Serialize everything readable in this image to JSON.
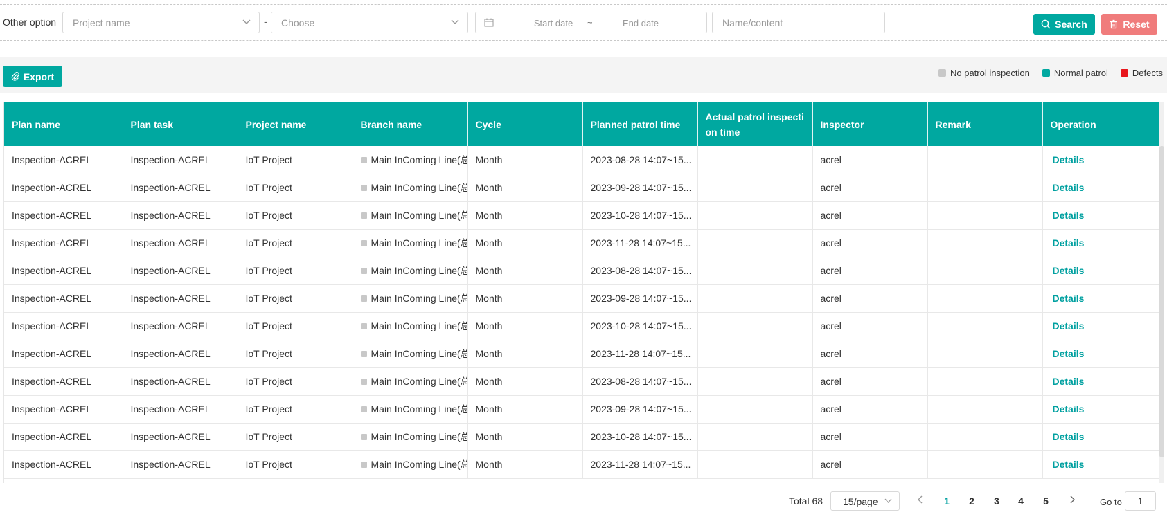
{
  "filters": {
    "label": "Other option",
    "project_placeholder": "Project name",
    "separator": "-",
    "choose_placeholder": "Choose",
    "start_placeholder": "Start date",
    "range_separator": "~",
    "end_placeholder": "End date",
    "name_placeholder": "Name/content",
    "search_label": "Search",
    "reset_label": "Reset"
  },
  "toolbar": {
    "export_label": "Export",
    "legend": [
      {
        "label": "No patrol inspection",
        "color": "#c8c8c8"
      },
      {
        "label": "Normal patrol",
        "color": "#00a8a0"
      },
      {
        "label": "Defects",
        "color": "#e8151b"
      }
    ]
  },
  "table": {
    "columns": [
      "Plan name",
      "Plan task",
      "Project name",
      "Branch name",
      "Cycle",
      "Planned patrol time",
      "Actual patrol inspecti on time",
      "Inspector",
      "Remark",
      "Operation"
    ],
    "rows": [
      {
        "plan": "Inspection-ACREL",
        "task": "Inspection-ACREL",
        "project": "IoT Project",
        "branch": "Main InComing Line(总",
        "cycle": "Month",
        "planned": "2023-08-28 14:07~15...",
        "actual": "",
        "inspector": "acrel",
        "remark": "",
        "op": "Details"
      },
      {
        "plan": "Inspection-ACREL",
        "task": "Inspection-ACREL",
        "project": "IoT Project",
        "branch": "Main InComing Line(总",
        "cycle": "Month",
        "planned": "2023-09-28 14:07~15...",
        "actual": "",
        "inspector": "acrel",
        "remark": "",
        "op": "Details"
      },
      {
        "plan": "Inspection-ACREL",
        "task": "Inspection-ACREL",
        "project": "IoT Project",
        "branch": "Main InComing Line(总",
        "cycle": "Month",
        "planned": "2023-10-28 14:07~15...",
        "actual": "",
        "inspector": "acrel",
        "remark": "",
        "op": "Details"
      },
      {
        "plan": "Inspection-ACREL",
        "task": "Inspection-ACREL",
        "project": "IoT Project",
        "branch": "Main InComing Line(总",
        "cycle": "Month",
        "planned": "2023-11-28 14:07~15...",
        "actual": "",
        "inspector": "acrel",
        "remark": "",
        "op": "Details"
      },
      {
        "plan": "Inspection-ACREL",
        "task": "Inspection-ACREL",
        "project": "IoT Project",
        "branch": "Main InComing Line(总",
        "cycle": "Month",
        "planned": "2023-08-28 14:07~15...",
        "actual": "",
        "inspector": "acrel",
        "remark": "",
        "op": "Details"
      },
      {
        "plan": "Inspection-ACREL",
        "task": "Inspection-ACREL",
        "project": "IoT Project",
        "branch": "Main InComing Line(总",
        "cycle": "Month",
        "planned": "2023-09-28 14:07~15...",
        "actual": "",
        "inspector": "acrel",
        "remark": "",
        "op": "Details"
      },
      {
        "plan": "Inspection-ACREL",
        "task": "Inspection-ACREL",
        "project": "IoT Project",
        "branch": "Main InComing Line(总",
        "cycle": "Month",
        "planned": "2023-10-28 14:07~15...",
        "actual": "",
        "inspector": "acrel",
        "remark": "",
        "op": "Details"
      },
      {
        "plan": "Inspection-ACREL",
        "task": "Inspection-ACREL",
        "project": "IoT Project",
        "branch": "Main InComing Line(总",
        "cycle": "Month",
        "planned": "2023-11-28 14:07~15...",
        "actual": "",
        "inspector": "acrel",
        "remark": "",
        "op": "Details"
      },
      {
        "plan": "Inspection-ACREL",
        "task": "Inspection-ACREL",
        "project": "IoT Project",
        "branch": "Main InComing Line(总",
        "cycle": "Month",
        "planned": "2023-08-28 14:07~15...",
        "actual": "",
        "inspector": "acrel",
        "remark": "",
        "op": "Details"
      },
      {
        "plan": "Inspection-ACREL",
        "task": "Inspection-ACREL",
        "project": "IoT Project",
        "branch": "Main InComing Line(总",
        "cycle": "Month",
        "planned": "2023-09-28 14:07~15...",
        "actual": "",
        "inspector": "acrel",
        "remark": "",
        "op": "Details"
      },
      {
        "plan": "Inspection-ACREL",
        "task": "Inspection-ACREL",
        "project": "IoT Project",
        "branch": "Main InComing Line(总",
        "cycle": "Month",
        "planned": "2023-10-28 14:07~15...",
        "actual": "",
        "inspector": "acrel",
        "remark": "",
        "op": "Details"
      },
      {
        "plan": "Inspection-ACREL",
        "task": "Inspection-ACREL",
        "project": "IoT Project",
        "branch": "Main InComing Line(总",
        "cycle": "Month",
        "planned": "2023-11-28 14:07~15...",
        "actual": "",
        "inspector": "acrel",
        "remark": "",
        "op": "Details"
      }
    ]
  },
  "pagination": {
    "total": "Total 68",
    "page_size": "15/page",
    "pages": [
      "1",
      "2",
      "3",
      "4",
      "5"
    ],
    "current": "1",
    "goto_label": "Go to",
    "goto_value": "1"
  }
}
